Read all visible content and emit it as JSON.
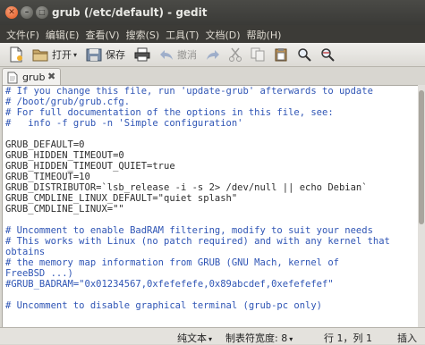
{
  "window": {
    "title": "grub (/etc/default) - gedit"
  },
  "menubar": {
    "items": [
      {
        "label": "文件(F)"
      },
      {
        "label": "编辑(E)"
      },
      {
        "label": "查看(V)"
      },
      {
        "label": "搜索(S)"
      },
      {
        "label": "工具(T)"
      },
      {
        "label": "文档(D)"
      },
      {
        "label": "帮助(H)"
      }
    ]
  },
  "toolbar": {
    "open_label": "打开",
    "save_label": "保存",
    "undo_label": "撤消"
  },
  "tab": {
    "label": "grub"
  },
  "editor": {
    "lines": [
      "# If you change this file, run 'update-grub' afterwards to update",
      "# /boot/grub/grub.cfg.",
      "# For full documentation of the options in this file, see:",
      "#   info -f grub -n 'Simple configuration'",
      "",
      "GRUB_DEFAULT=0",
      "GRUB_HIDDEN_TIMEOUT=0",
      "GRUB_HIDDEN_TIMEOUT_QUIET=true",
      "GRUB_TIMEOUT=10",
      "GRUB_DISTRIBUTOR=`lsb_release -i -s 2> /dev/null || echo Debian`",
      "GRUB_CMDLINE_LINUX_DEFAULT=\"quiet splash\"",
      "GRUB_CMDLINE_LINUX=\"\"",
      "",
      "# Uncomment to enable BadRAM filtering, modify to suit your needs",
      "# This works with Linux (no patch required) and with any kernel that",
      "obtains",
      "# the memory map information from GRUB (GNU Mach, kernel of",
      "FreeBSD ...)",
      "#GRUB_BADRAM=\"0x01234567,0xfefefefe,0x89abcdef,0xefefefef\"",
      "",
      "# Uncomment to disable graphical terminal (grub-pc only)"
    ]
  },
  "statusbar": {
    "language": "纯文本",
    "tab_width": "制表符宽度: 8",
    "position": "行 1，列 1",
    "mode": "插入"
  },
  "colors": {
    "comment": "#2f55b5",
    "text": "#2d2d2d",
    "titlebar": "#3c3b37",
    "close_button": "#e2561c"
  },
  "icons": [
    "new-document-icon",
    "open-folder-icon",
    "save-icon",
    "print-icon",
    "undo-icon",
    "redo-icon",
    "cut-icon",
    "copy-icon",
    "paste-icon",
    "search-icon",
    "replace-icon"
  ]
}
